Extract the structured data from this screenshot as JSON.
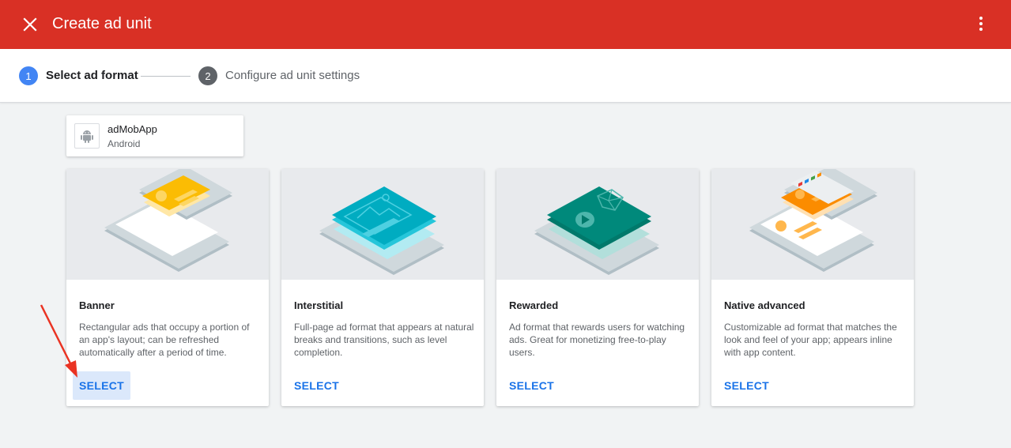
{
  "header": {
    "title": "Create ad unit",
    "close_icon": "close-icon",
    "more_icon": "more-vert-icon"
  },
  "stepper": {
    "steps": [
      {
        "number": "1",
        "label": "Select ad format"
      },
      {
        "number": "2",
        "label": "Configure ad unit settings"
      }
    ]
  },
  "app": {
    "name": "adMobApp",
    "platform": "Android",
    "icon": "android-icon"
  },
  "formats": [
    {
      "title": "Banner",
      "description": "Rectangular ads that occupy a portion of an app's layout; can be refreshed automatically after a period of time.",
      "button": "SELECT"
    },
    {
      "title": "Interstitial",
      "description": "Full-page ad format that appears at natural breaks and transitions, such as level completion.",
      "button": "SELECT"
    },
    {
      "title": "Rewarded",
      "description": "Ad format that rewards users for watching ads. Great for monetizing free-to-play users.",
      "button": "SELECT"
    },
    {
      "title": "Native advanced",
      "description": "Customizable ad format that matches the look and feel of your app; appears inline with app content.",
      "button": "SELECT"
    }
  ],
  "colors": {
    "header": "#d93025",
    "accent": "#1a73e8",
    "step_active": "#4285f4",
    "annotation_arrow": "#ea3323"
  }
}
